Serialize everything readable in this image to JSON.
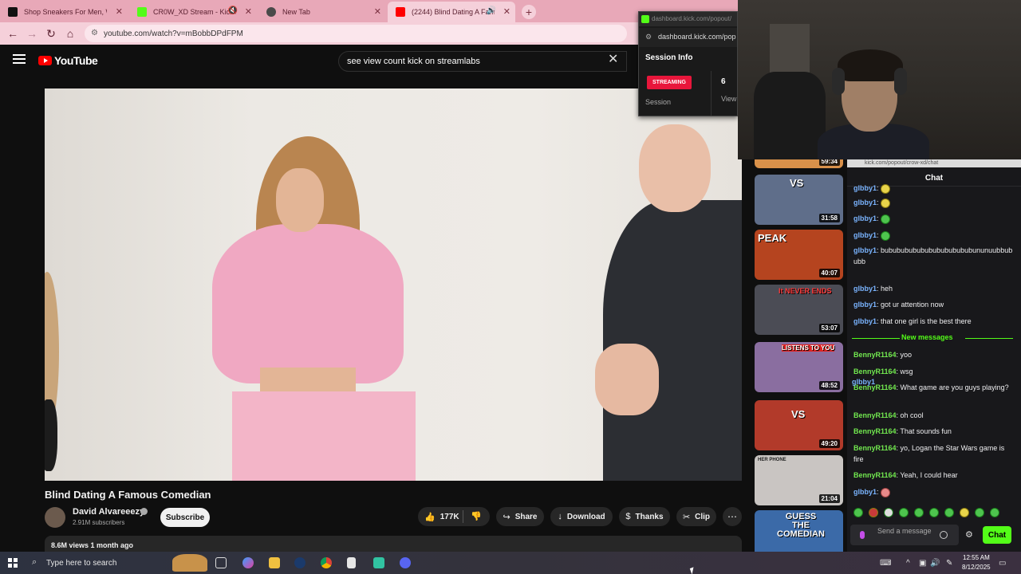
{
  "browser": {
    "tabs": [
      {
        "label": "Shop Sneakers For Men, Wom",
        "favicon_color": "#111111"
      },
      {
        "label": "CR0W_XD Stream - Kick Da",
        "favicon_color": "#53fc18"
      },
      {
        "label": "New Tab",
        "favicon_color": "#4a4a4a"
      },
      {
        "label": "(2244) Blind Dating A Famou",
        "favicon_color": "#ff0000"
      }
    ],
    "url": "youtube.com/watch?v=mBobbDPdFPM"
  },
  "youtube": {
    "logo_text": "YouTube",
    "search_query": "see view count kick on streamlabs",
    "video_title": "Blind Dating A Famous Comedian",
    "channel_name": "David Alvareeezy",
    "subscribers": "2.91M subscribers",
    "subscribe_label": "Subscribe",
    "likes": "177K",
    "share_label": "Share",
    "download_label": "Download",
    "thanks_label": "Thanks",
    "clip_label": "Clip",
    "views_line": "8.6M views  1 month ago"
  },
  "related": [
    {
      "duration": "59:34",
      "caption": "",
      "color": "#d9914a"
    },
    {
      "duration": "31:58",
      "caption": "VS",
      "color": "#5f6e8a"
    },
    {
      "duration": "40:07",
      "caption": "PEAK",
      "color": "#b5441f"
    },
    {
      "duration": "53:07",
      "caption": "It NEVER ENDS",
      "color": "#4b4c55"
    },
    {
      "duration": "48:52",
      "caption": "LISTENS TO YOU",
      "color": "#8a6ea0"
    },
    {
      "duration": "49:20",
      "caption": "VS",
      "color": "#b23a2a"
    },
    {
      "duration": "21:04",
      "caption": "HER PHONE",
      "color": "#c9c5c2"
    },
    {
      "duration": "",
      "caption": "GUESS THE COMEDIAN",
      "color": "#3b6aa8"
    }
  ],
  "kick_popup": {
    "window_url": "dashboard.kick.com/popout/",
    "url": "dashboard.kick.com/pop",
    "title": "Session Info",
    "status": "STREAMING",
    "session_label": "Session",
    "viewer_count": "6",
    "viewers_label": "View"
  },
  "chat": {
    "url": "kick.com/popout/crow-xd/chat",
    "header": "Chat",
    "messages": [
      {
        "user": "glbby1",
        "text": "",
        "emote": "y",
        "color": "g"
      },
      {
        "user": "glbby1",
        "text": "",
        "emote": "y",
        "color": "g"
      },
      {
        "user": "glbby1",
        "text": "",
        "emote": "g",
        "color": "g"
      },
      {
        "user": "glbby1",
        "text": "",
        "emote": "g",
        "color": "g"
      },
      {
        "user": "glbby1",
        "text": "bubububububububububububununuubbububb",
        "emote": "",
        "color": "g"
      },
      {
        "user": "glbby1",
        "text": "heh",
        "emote": "",
        "color": "g"
      },
      {
        "user": "glbby1",
        "text": "got ur attention now",
        "emote": "",
        "color": "g"
      },
      {
        "user": "glbby1",
        "text": "that one girl is the best there",
        "emote": "",
        "color": "g"
      },
      {
        "user": "BennyR1164",
        "text": "yoo",
        "emote": "",
        "color": "b"
      },
      {
        "user": "BennyR1164",
        "text": "wsg",
        "emote": "",
        "color": "b"
      },
      {
        "user": "BennyR1164",
        "text": "What game are you guys playing?",
        "emote": "",
        "color": "b"
      },
      {
        "user": "BennyR1164",
        "text": "oh cool",
        "emote": "",
        "color": "b"
      },
      {
        "user": "BennyR1164",
        "text": "That sounds fun",
        "emote": "",
        "color": "b"
      },
      {
        "user": "BennyR1164",
        "text": "yo, Logan the Star Wars game is fire",
        "emote": "",
        "color": "b"
      },
      {
        "user": "BennyR1164",
        "text": "Yeah, I could hear",
        "emote": "",
        "color": "b"
      },
      {
        "user": "glbby1",
        "text": "",
        "emote": "y",
        "color": "g"
      }
    ],
    "new_messages_label": "New messages",
    "scroll_user": "glbby1",
    "input_placeholder": "Send a message",
    "send_label": "Chat"
  },
  "taskbar": {
    "search_placeholder": "Type here to search",
    "time": "12:55 AM",
    "date": "8/12/2025"
  }
}
